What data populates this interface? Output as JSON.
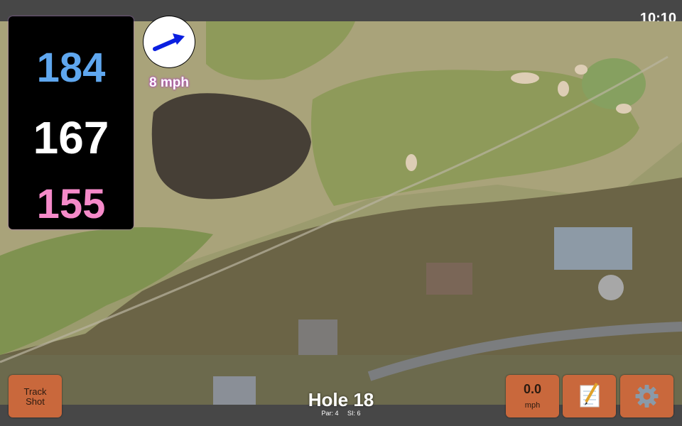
{
  "status_bar": {
    "time": "10:10"
  },
  "distances": {
    "back": "184",
    "middle": "167",
    "front": "155"
  },
  "wind": {
    "speed_label": "8 mph",
    "icon": "wind-direction-arrow-icon"
  },
  "hole": {
    "title": "Hole 18",
    "par": "Par: 4",
    "stroke_index": "SI: 6"
  },
  "buttons": {
    "track_shot": [
      "Track",
      "Shot"
    ],
    "speed_value": "0.0",
    "speed_unit": "mph",
    "notes_icon": "notepad-icon",
    "settings_icon": "gear-icon"
  },
  "colors": {
    "back": "#5fa7ef",
    "middle": "#ffffff",
    "front": "#f58ac9",
    "button": "#c9683c",
    "accent": "#b03fbf"
  }
}
